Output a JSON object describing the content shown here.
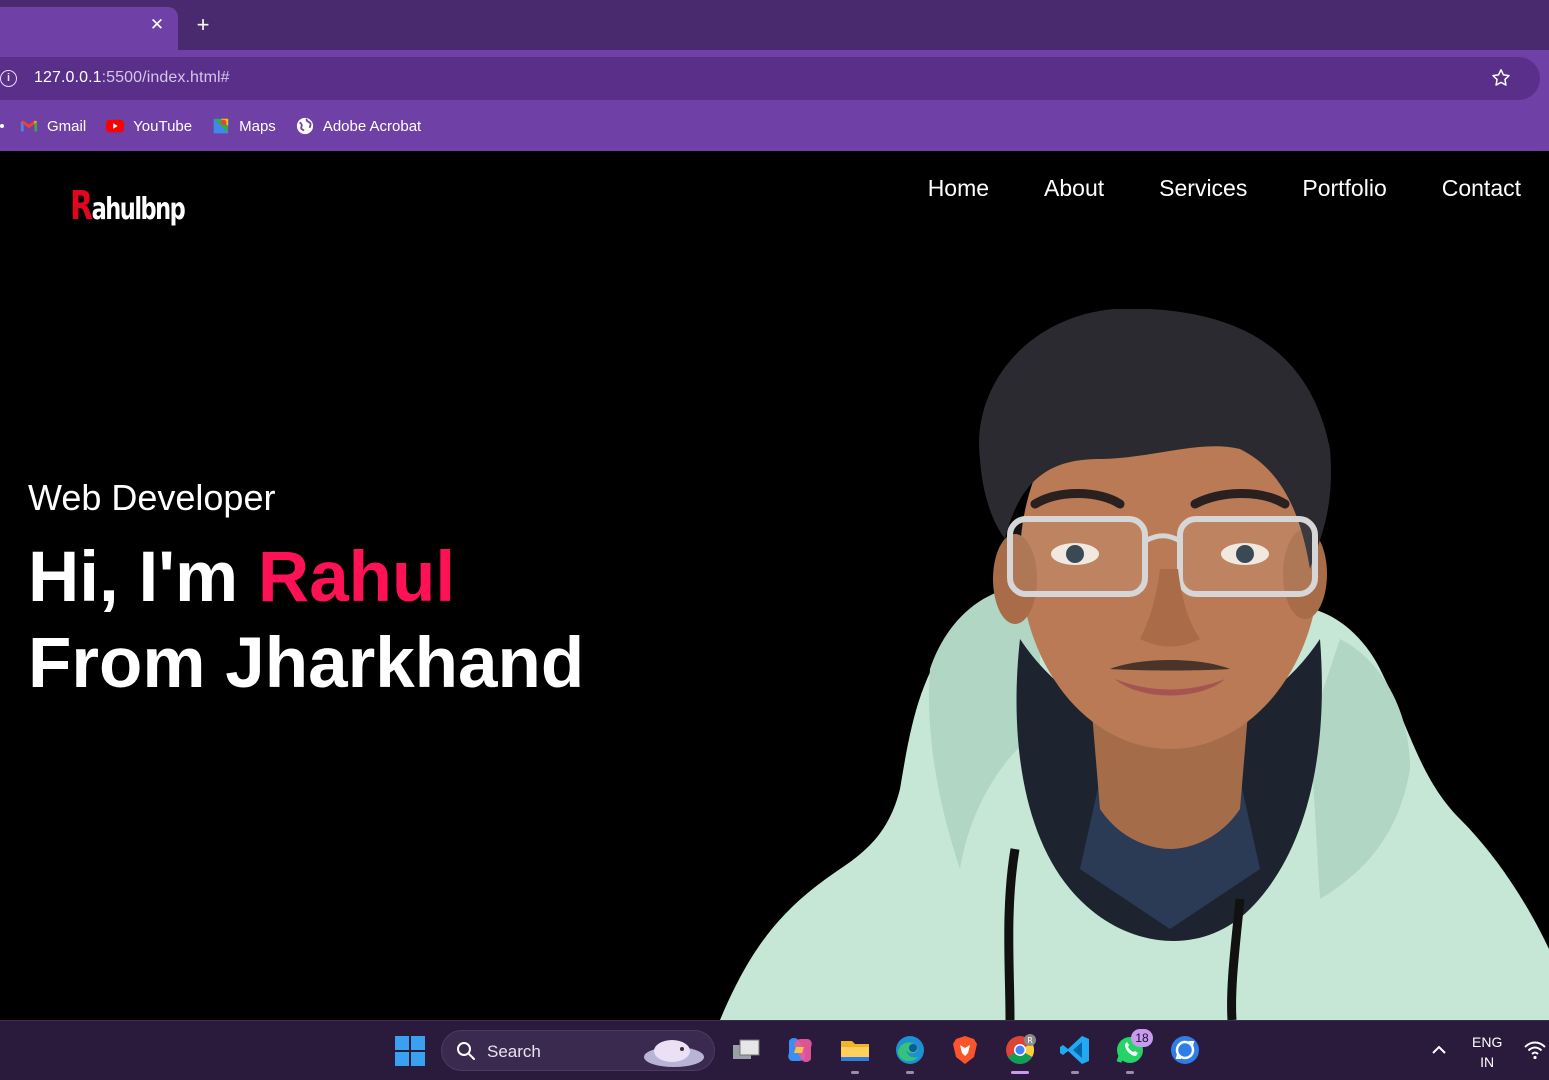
{
  "browser": {
    "tab_close_label": "✕",
    "new_tab_label": "+",
    "url_host": "127.0.0.1",
    "url_rest": ":5500/index.html#",
    "bookmarks": [
      {
        "label": "Gmail",
        "icon": "gmail-icon"
      },
      {
        "label": "YouTube",
        "icon": "youtube-icon"
      },
      {
        "label": "Maps",
        "icon": "maps-icon"
      },
      {
        "label": "Adobe Acrobat",
        "icon": "globe-icon"
      }
    ]
  },
  "site": {
    "logo_first": "R",
    "logo_rest": "ahulbnp",
    "nav": [
      "Home",
      "About",
      "Services",
      "Portfolio",
      "Contact"
    ],
    "hero_sub": "Web Developer",
    "hero_greeting": "Hi, I'm ",
    "hero_name": "Rahul",
    "hero_line2": "From Jharkhand",
    "accent_color": "#ff1155",
    "logo_accent_color": "#e0061e"
  },
  "taskbar": {
    "search_placeholder": "Search",
    "whatsapp_badge": "18",
    "lang_line1": "ENG",
    "lang_line2": "IN",
    "apps": [
      "task-view-icon",
      "copilot-icon",
      "file-explorer-icon",
      "edge-icon",
      "brave-icon",
      "chrome-icon",
      "vscode-icon",
      "whatsapp-icon",
      "sync-app-icon"
    ]
  }
}
